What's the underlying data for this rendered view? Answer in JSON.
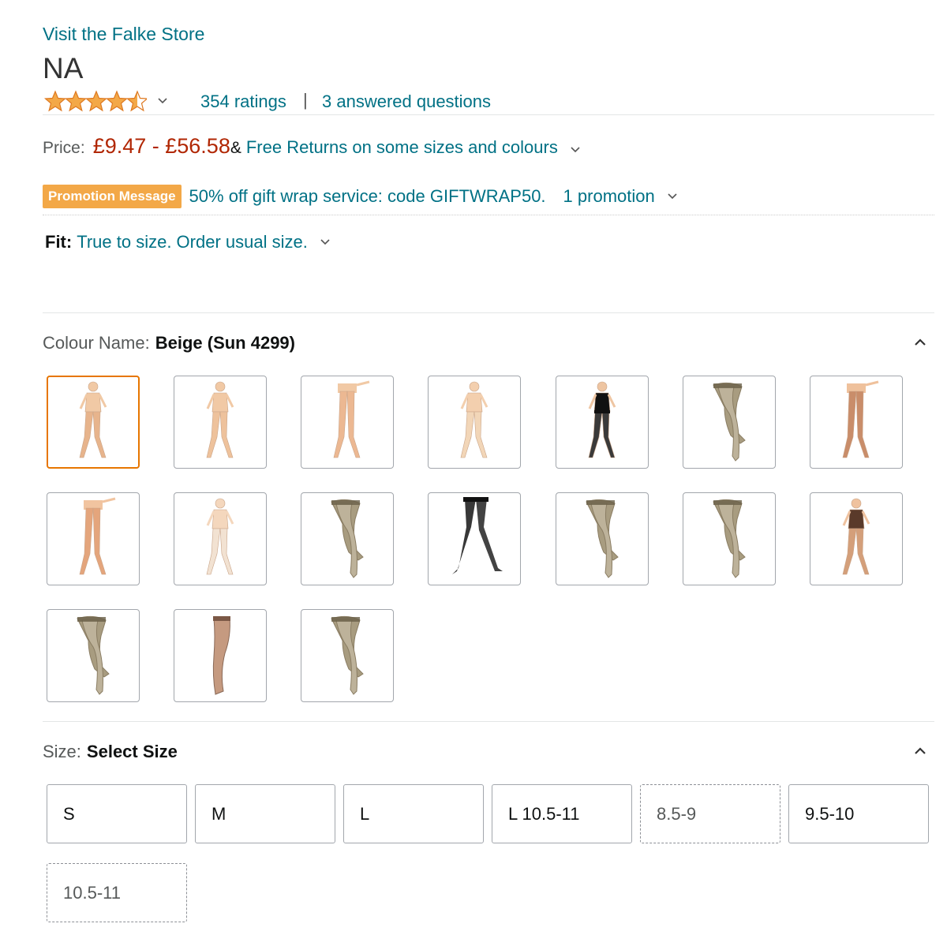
{
  "store_link": "Visit the Falke Store",
  "product_title": "NA",
  "rating": {
    "stars": 4.5,
    "ratings_text": "354 ratings",
    "separator": "|",
    "questions_text": "3 answered questions"
  },
  "price": {
    "label": "Price:",
    "range": "£9.47 - £56.58",
    "amp": "&",
    "returns_text": "Free Returns on some sizes and colours"
  },
  "promotion": {
    "badge": "Promotion Message",
    "text": "50% off gift wrap service: code GIFTWRAP50.",
    "count": "1 promotion"
  },
  "fit": {
    "label": "Fit:",
    "text": "True to size. Order usual size."
  },
  "colour": {
    "label": "Colour Name:",
    "selected": "Beige (Sun 4299)",
    "swatches": [
      {
        "icon": "full-body-beige-tights-icon",
        "selected": true
      },
      {
        "icon": "full-body-nude-tights-icon",
        "selected": false
      },
      {
        "icon": "legs-beige-tights-icon",
        "selected": false
      },
      {
        "icon": "full-body-pale-tights-icon",
        "selected": false
      },
      {
        "icon": "black-lingerie-stockings-icon",
        "selected": false
      },
      {
        "icon": "shiny-stockings-icon",
        "selected": false
      },
      {
        "icon": "legs-tan-stockings-icon",
        "selected": false
      },
      {
        "icon": "legs-tan-tights-icon",
        "selected": false
      },
      {
        "icon": "full-body-white-tights-icon",
        "selected": false
      },
      {
        "icon": "shiny-stockings-icon",
        "selected": false
      },
      {
        "icon": "black-sheer-stockings-icon",
        "selected": false
      },
      {
        "icon": "shiny-stockings-icon",
        "selected": false
      },
      {
        "icon": "shiny-stockings-icon",
        "selected": false
      },
      {
        "icon": "full-body-tan-stockings-icon",
        "selected": false
      },
      {
        "icon": "shiny-stockings-icon",
        "selected": false
      },
      {
        "icon": "single-leg-stocking-icon",
        "selected": false
      },
      {
        "icon": "shiny-stockings-icon",
        "selected": false
      }
    ]
  },
  "size": {
    "label": "Size:",
    "selected": "Select Size",
    "options": [
      {
        "label": "S",
        "available": true
      },
      {
        "label": "M",
        "available": true
      },
      {
        "label": "L",
        "available": true
      },
      {
        "label": "L 10.5-11",
        "available": true
      },
      {
        "label": "8.5-9",
        "available": false
      },
      {
        "label": "9.5-10",
        "available": true
      },
      {
        "label": "10.5-11",
        "available": false
      }
    ]
  },
  "colors": {
    "link": "#007185",
    "price": "#b12704",
    "promo_badge": "#f3a847",
    "selected_border": "#e77600",
    "star": "#f3a847"
  }
}
